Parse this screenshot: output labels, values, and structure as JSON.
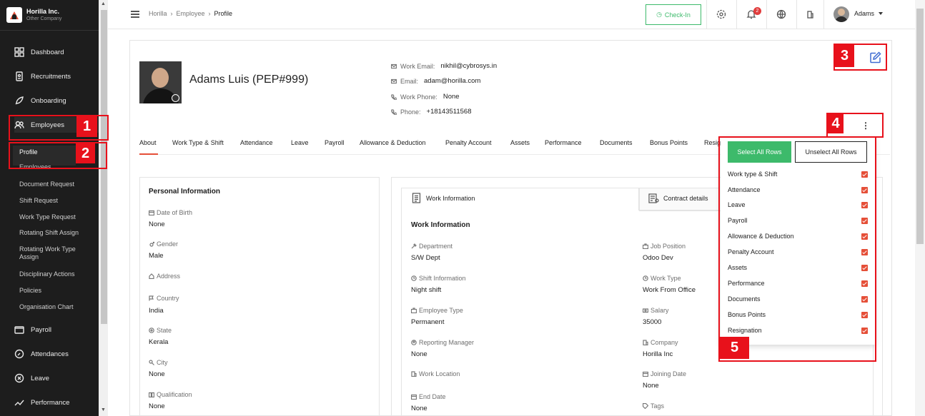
{
  "brand": {
    "name": "Horilla Inc.",
    "subtitle": "Other Company"
  },
  "sidebar": {
    "items": [
      {
        "label": "Dashboard",
        "icon": "dashboard-icon"
      },
      {
        "label": "Recruitments",
        "icon": "recruitment-icon"
      },
      {
        "label": "Onboarding",
        "icon": "rocket-icon"
      },
      {
        "label": "Employees",
        "icon": "users-icon"
      },
      {
        "label": "Payroll",
        "icon": "wallet-icon"
      },
      {
        "label": "Attendances",
        "icon": "clock-icon"
      },
      {
        "label": "Leave",
        "icon": "leave-icon"
      },
      {
        "label": "Performance",
        "icon": "chart-line-icon"
      }
    ],
    "employee_sub": [
      "Profile",
      "Employees",
      "Document Request",
      "Shift Request",
      "Work Type Request",
      "Rotating Shift Assign",
      "Rotating Work Type Assign",
      "Disciplinary Actions",
      "Policies",
      "Organisation Chart"
    ]
  },
  "topbar": {
    "breadcrumb": [
      "Horilla",
      "Employee",
      "Profile"
    ],
    "checkin_label": "Check-In",
    "notification_count": "2",
    "user_name": "Adams"
  },
  "profile": {
    "name": "Adams Luis (PEP#999)",
    "contacts": [
      {
        "label": "Work Email:",
        "value": "nikhil@cybrosys.in",
        "icon": "mail-icon"
      },
      {
        "label": "Email:",
        "value": "adam@horilla.com",
        "icon": "mail-icon"
      },
      {
        "label": "Work Phone:",
        "value": "None",
        "icon": "phone-icon"
      },
      {
        "label": "Phone:",
        "value": "+18143511568",
        "icon": "phone-icon"
      }
    ]
  },
  "tabs": [
    "About",
    "Work Type & Shift",
    "Attendance",
    "Leave",
    "Payroll",
    "Allowance & Deduction",
    "Penalty Account",
    "Assets",
    "Performance",
    "Documents",
    "Bonus Points",
    "Resignation"
  ],
  "personal_info": {
    "title": "Personal Information",
    "fields": [
      {
        "label": "Date of Birth",
        "value": "None"
      },
      {
        "label": "Gender",
        "value": "Male"
      },
      {
        "label": "Address",
        "value": ""
      },
      {
        "label": "Country",
        "value": "India"
      },
      {
        "label": "State",
        "value": "Kerala"
      },
      {
        "label": "City",
        "value": "None"
      },
      {
        "label": "Qualification",
        "value": "None"
      }
    ]
  },
  "work_info": {
    "tab_active": "Work Information",
    "tab_inactive": "Contract details",
    "title": "Work Information",
    "left_fields": [
      {
        "label": "Department",
        "value": "S/W Dept"
      },
      {
        "label": "Shift Information",
        "value": "Night shift"
      },
      {
        "label": "Employee Type",
        "value": "Permanent"
      },
      {
        "label": "Reporting Manager",
        "value": "None"
      },
      {
        "label": "Work Location",
        "value": ""
      },
      {
        "label": "End Date",
        "value": "None"
      }
    ],
    "right_fields": [
      {
        "label": "Job Position",
        "value": "Odoo Dev"
      },
      {
        "label": "Work Type",
        "value": "Work From Office"
      },
      {
        "label": "Salary",
        "value": "35000"
      },
      {
        "label": "Company",
        "value": "Horilla Inc"
      },
      {
        "label": "Joining Date",
        "value": "None"
      },
      {
        "label": "Tags",
        "value": ""
      }
    ]
  },
  "column_dropdown": {
    "select_all": "Select All Rows",
    "unselect_all": "Unselect All Rows",
    "options": [
      "Work type & Shift",
      "Attendance",
      "Leave",
      "Payroll",
      "Allowance & Deduction",
      "Penalty Account",
      "Assets",
      "Performance",
      "Documents",
      "Bonus Points",
      "Resignation"
    ],
    "kebab": "⋮"
  },
  "annotations": [
    "1",
    "2",
    "3",
    "4",
    "5"
  ],
  "colors": {
    "accent": "#e54f38",
    "success": "#3dba6b",
    "annotation": "#e8111b",
    "link_blue": "#3e6bd1"
  }
}
